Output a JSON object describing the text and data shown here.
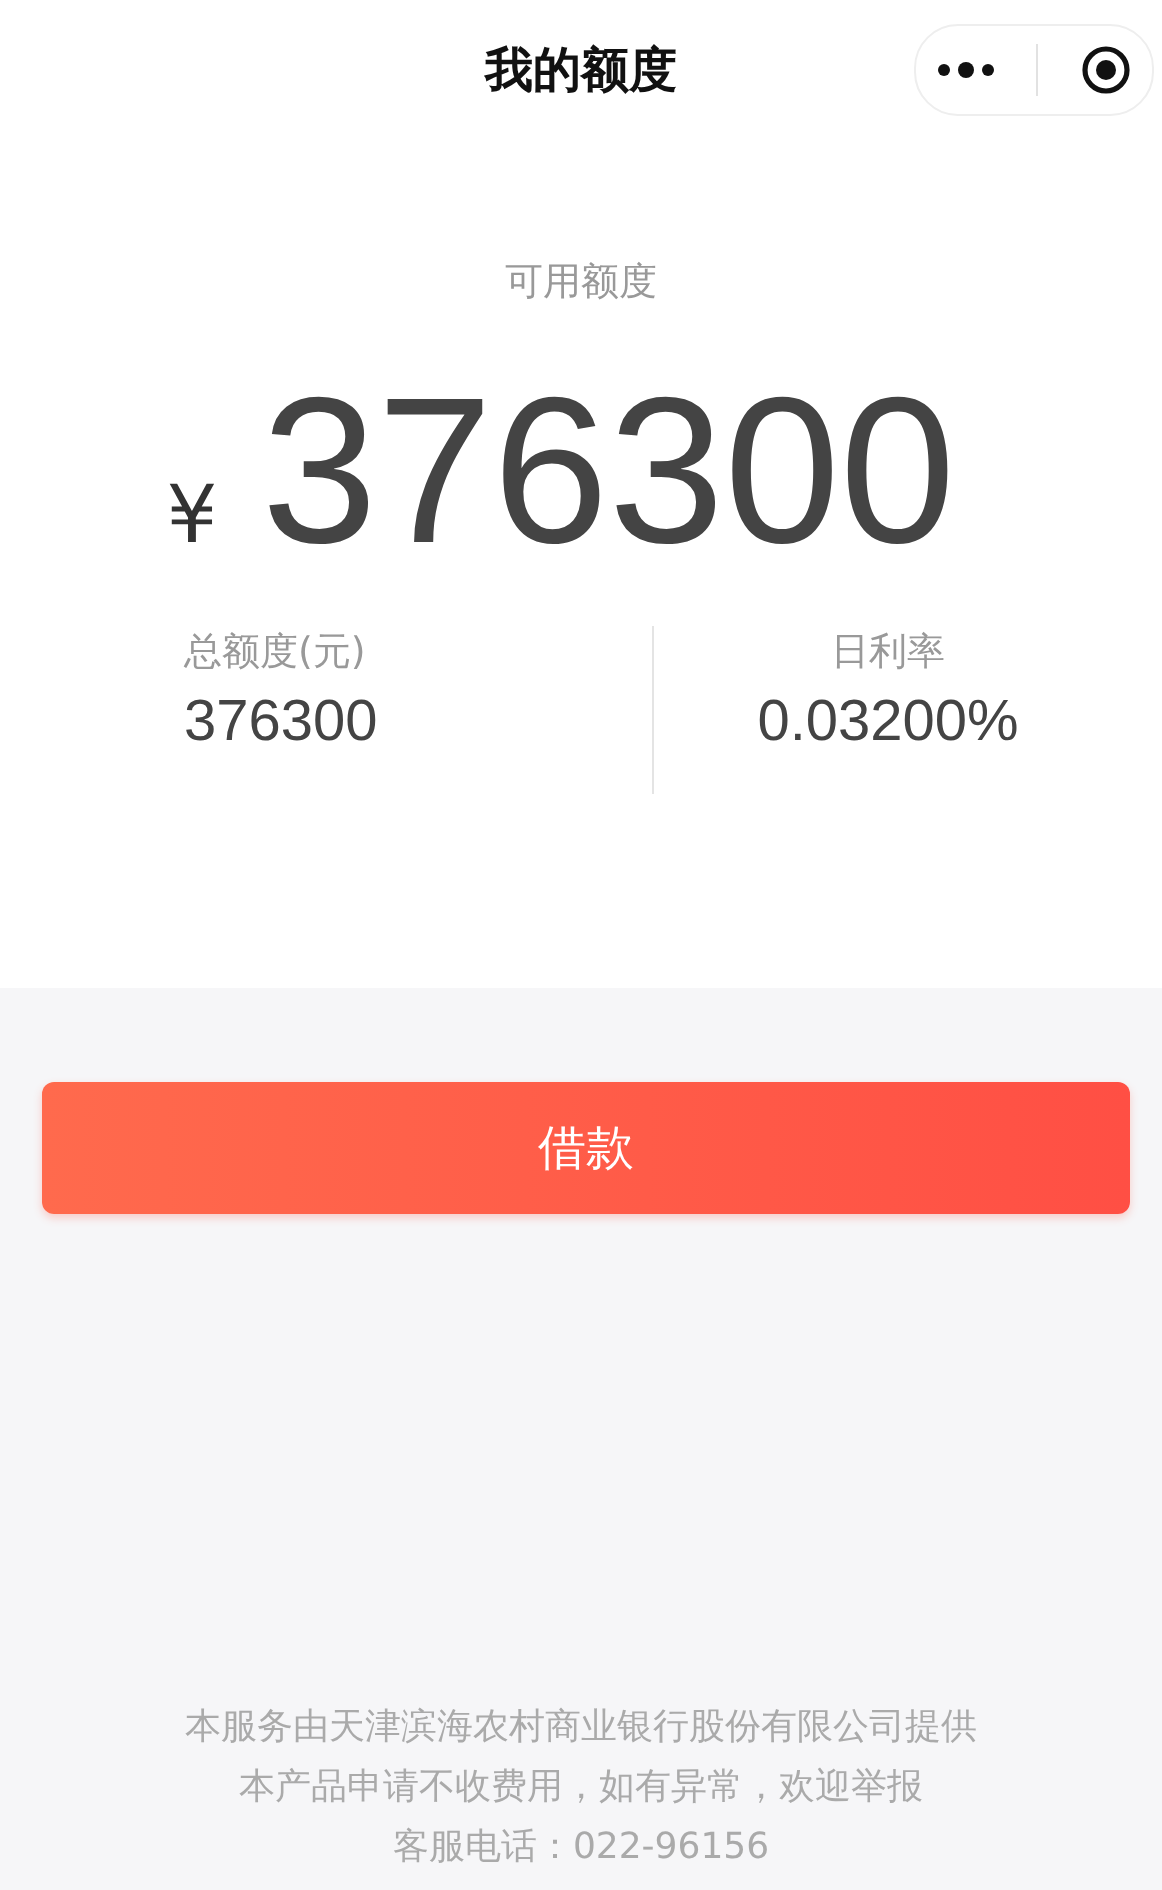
{
  "nav_bar": {
    "title": "我的额度"
  },
  "credit": {
    "label": "可用额度",
    "currency": "¥",
    "amount": "376300"
  },
  "stats": [
    {
      "label": "总额度(元)",
      "value": "376300"
    },
    {
      "label": "日利率",
      "value": "0.03200%"
    }
  ],
  "borrow_button": {
    "label": "借款"
  },
  "footer": [
    "本服务由天津滨海农村商业银行股份有限公司提供",
    "本产品申请不收费用，如有异常，欢迎举报",
    "客服电话：022-96156"
  ]
}
